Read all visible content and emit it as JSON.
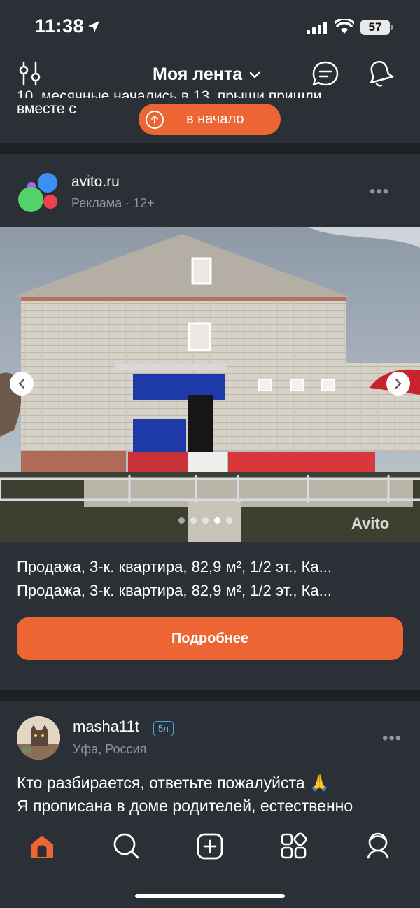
{
  "status_bar": {
    "time": "11:38",
    "battery": "57"
  },
  "header": {
    "title": "Моя лента"
  },
  "previous_post": {
    "line1": "10, месячные начались в 13, прыщи пришли",
    "line2": "вместе с"
  },
  "scroll_top_button": {
    "label": "в начало"
  },
  "ad_post": {
    "author": "avito.ru",
    "meta": "Реклама · 12+",
    "photo": {
      "slide_count": 5,
      "active_slide": 4,
      "watermark": "Avito"
    },
    "title_line1": "Продажа, 3-к. квартира, 82,9 м², 1/2 эт., Ка...",
    "title_line2": "Продажа, 3-к. квартира, 82,9 м², 1/2 эт., Ка...",
    "button_label": "Подробнее"
  },
  "user_post": {
    "username": "masha11t",
    "badge": "5л",
    "location": "Уфа, Россия",
    "text_line1": "Кто разбирается, ответьте пожалуйста 🙏",
    "text_line2": "Я прописана в доме родителей, естественно"
  },
  "tab_bar": {
    "tabs": [
      {
        "icon": "home-icon",
        "active": true
      },
      {
        "icon": "search-icon",
        "active": false
      },
      {
        "icon": "create-post-icon",
        "active": false
      },
      {
        "icon": "services-icon",
        "active": false
      },
      {
        "icon": "profile-icon",
        "active": false
      }
    ]
  },
  "colors": {
    "accent": "#ec6532",
    "background": "#2b2f36",
    "divider": "#1d2025",
    "muted_text": "#8f959d"
  }
}
